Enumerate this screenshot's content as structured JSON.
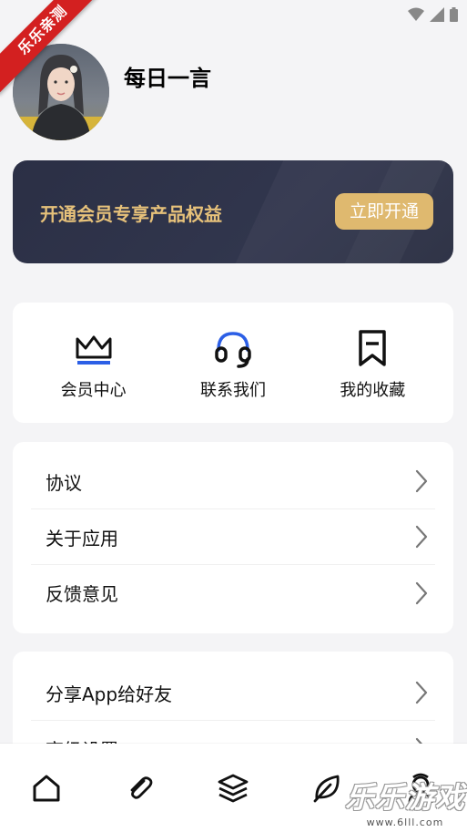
{
  "ribbon": "乐乐亲测",
  "profile": {
    "name": "每日一言"
  },
  "vip": {
    "title": "开通会员专享产品权益",
    "button": "立即开通"
  },
  "quick_actions": [
    {
      "label": "会员中心",
      "icon": "crown-icon"
    },
    {
      "label": "联系我们",
      "icon": "headset-icon"
    },
    {
      "label": "我的收藏",
      "icon": "bookmark-icon"
    }
  ],
  "menu1": [
    {
      "label": "协议"
    },
    {
      "label": "关于应用"
    },
    {
      "label": "反馈意见"
    }
  ],
  "menu2": [
    {
      "label": "分享App给好友"
    },
    {
      "label": "高级设置"
    }
  ],
  "nav": [
    {
      "icon": "home-icon"
    },
    {
      "icon": "paperclip-icon"
    },
    {
      "icon": "layers-icon"
    },
    {
      "icon": "leaf-icon"
    },
    {
      "icon": "profile-icon"
    }
  ],
  "watermark": {
    "big": "乐乐游戏",
    "small": "www.6lll.com"
  },
  "colors": {
    "accent_gold": "#e6c17a",
    "button_gold": "#dfb96f",
    "banner_bg": "#2b2f45",
    "headset_blue": "#2c5fe6"
  }
}
